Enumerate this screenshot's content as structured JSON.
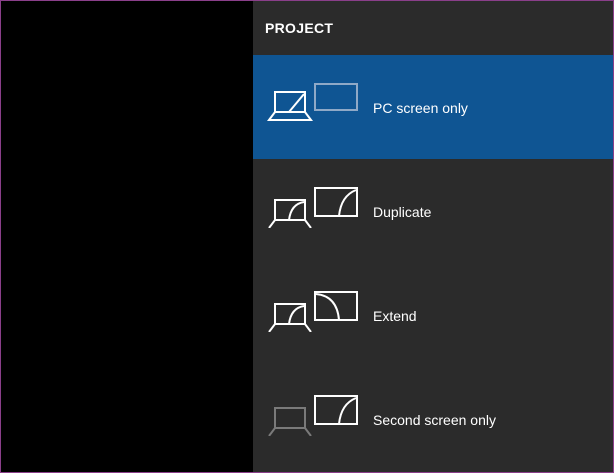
{
  "panel": {
    "title": "PROJECT"
  },
  "options": [
    {
      "label": "PC screen only",
      "selected": true,
      "icon": "pc-screen-only-icon"
    },
    {
      "label": "Duplicate",
      "selected": false,
      "icon": "duplicate-icon"
    },
    {
      "label": "Extend",
      "selected": false,
      "icon": "extend-icon"
    },
    {
      "label": "Second screen only",
      "selected": false,
      "icon": "second-screen-only-icon"
    }
  ],
  "colors": {
    "panel_background": "#2b2b2b",
    "selected_background": "#0f5593",
    "text": "#ffffff",
    "dimmed_icon": "#7a7a7a",
    "dimmed_icon_on_selected": "#8fa9c7",
    "window_border": "#8a3f8a"
  }
}
